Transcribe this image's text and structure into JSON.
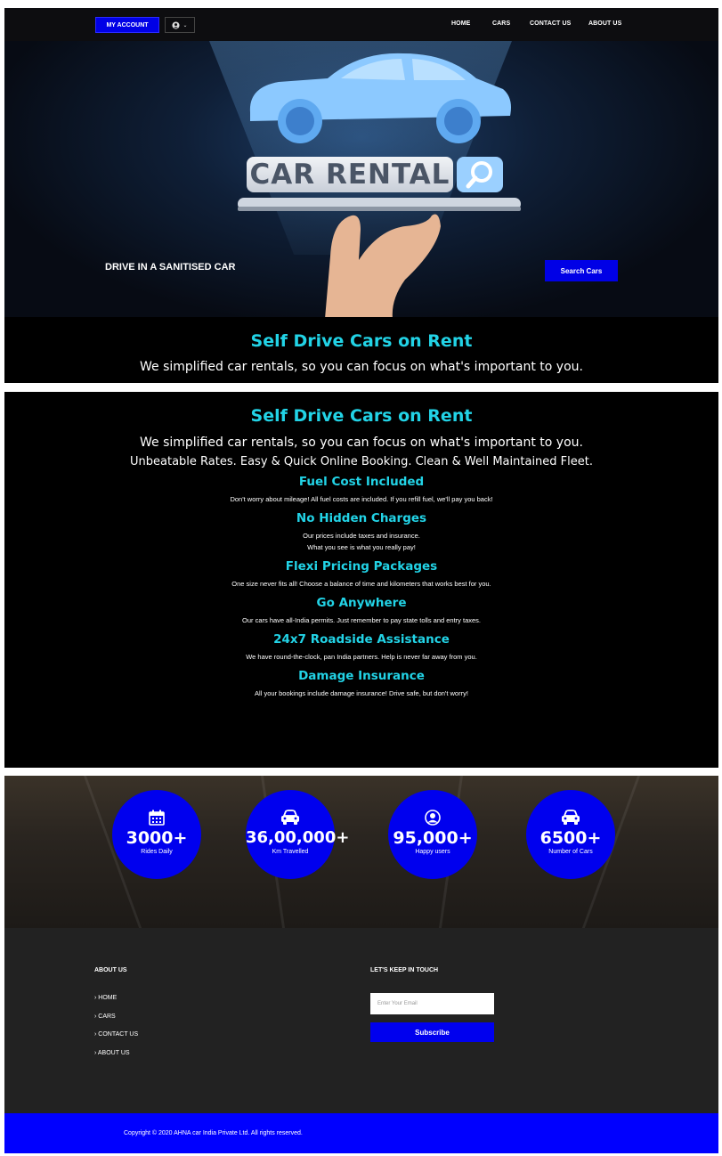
{
  "header": {
    "account_label": "MY ACCOUNT",
    "user_icon": "user-circle-icon",
    "nav": [
      {
        "label": "HOME"
      },
      {
        "label": "CARS"
      },
      {
        "label": "CONTACT US"
      },
      {
        "label": "ABOUT US"
      }
    ]
  },
  "hero": {
    "sign_text": "CAR RENTAL",
    "tagline": "DRIVE IN A SANITISED CAR",
    "search_button": "Search Cars"
  },
  "intro": {
    "title": "Self Drive Cars on Rent",
    "subtitle": "We simplified car rentals, so you can focus on what's important to you.",
    "tagline": "Unbeatable Rates. Easy & Quick Online Booking. Clean & Well Maintained Fleet."
  },
  "features": [
    {
      "title": "Fuel Cost Included",
      "lines": [
        "Don't worry about mileage! All fuel costs are included. If you refill fuel, we'll pay you back!"
      ]
    },
    {
      "title": "No Hidden Charges",
      "lines": [
        "Our prices include taxes and insurance.",
        "What you see is what you really pay!"
      ]
    },
    {
      "title": "Flexi Pricing Packages",
      "lines": [
        "One size never fits all! Choose a balance of time and kilometers that works best for you."
      ]
    },
    {
      "title": "Go Anywhere",
      "lines": [
        "Our cars have all-India permits. Just remember to pay state tolls and entry taxes."
      ]
    },
    {
      "title": "24x7 Roadside Assistance",
      "lines": [
        "We have round-the-clock, pan India partners. Help is never far away from you."
      ]
    },
    {
      "title": "Damage Insurance",
      "lines": [
        "All your bookings include damage insurance! Drive safe, but don't worry!"
      ]
    }
  ],
  "stats": [
    {
      "icon": "calendar-icon",
      "value": "3000+",
      "label": "Rides Daily"
    },
    {
      "icon": "car-icon",
      "value": "36,00,000+",
      "label": "Km Travelled"
    },
    {
      "icon": "user-circle-icon",
      "value": "95,000+",
      "label": "Happy users"
    },
    {
      "icon": "car-icon",
      "value": "6500+",
      "label": "Number of Cars"
    }
  ],
  "footer": {
    "about_heading": "ABOUT US",
    "links": [
      {
        "label": "HOME"
      },
      {
        "label": "CARS"
      },
      {
        "label": "CONTACT US"
      },
      {
        "label": "ABOUT US"
      }
    ],
    "contact_heading": "LET'S KEEP IN TOUCH",
    "email_placeholder": "Enter Your Email",
    "subscribe_label": "Subscribe",
    "copyright": "Copyright © 2020 AHNA car India Private Ltd. All rights reserved."
  },
  "colors": {
    "accent_blue": "#0000ee",
    "heading_teal": "#22d3e6",
    "footer_bg": "#222222"
  }
}
